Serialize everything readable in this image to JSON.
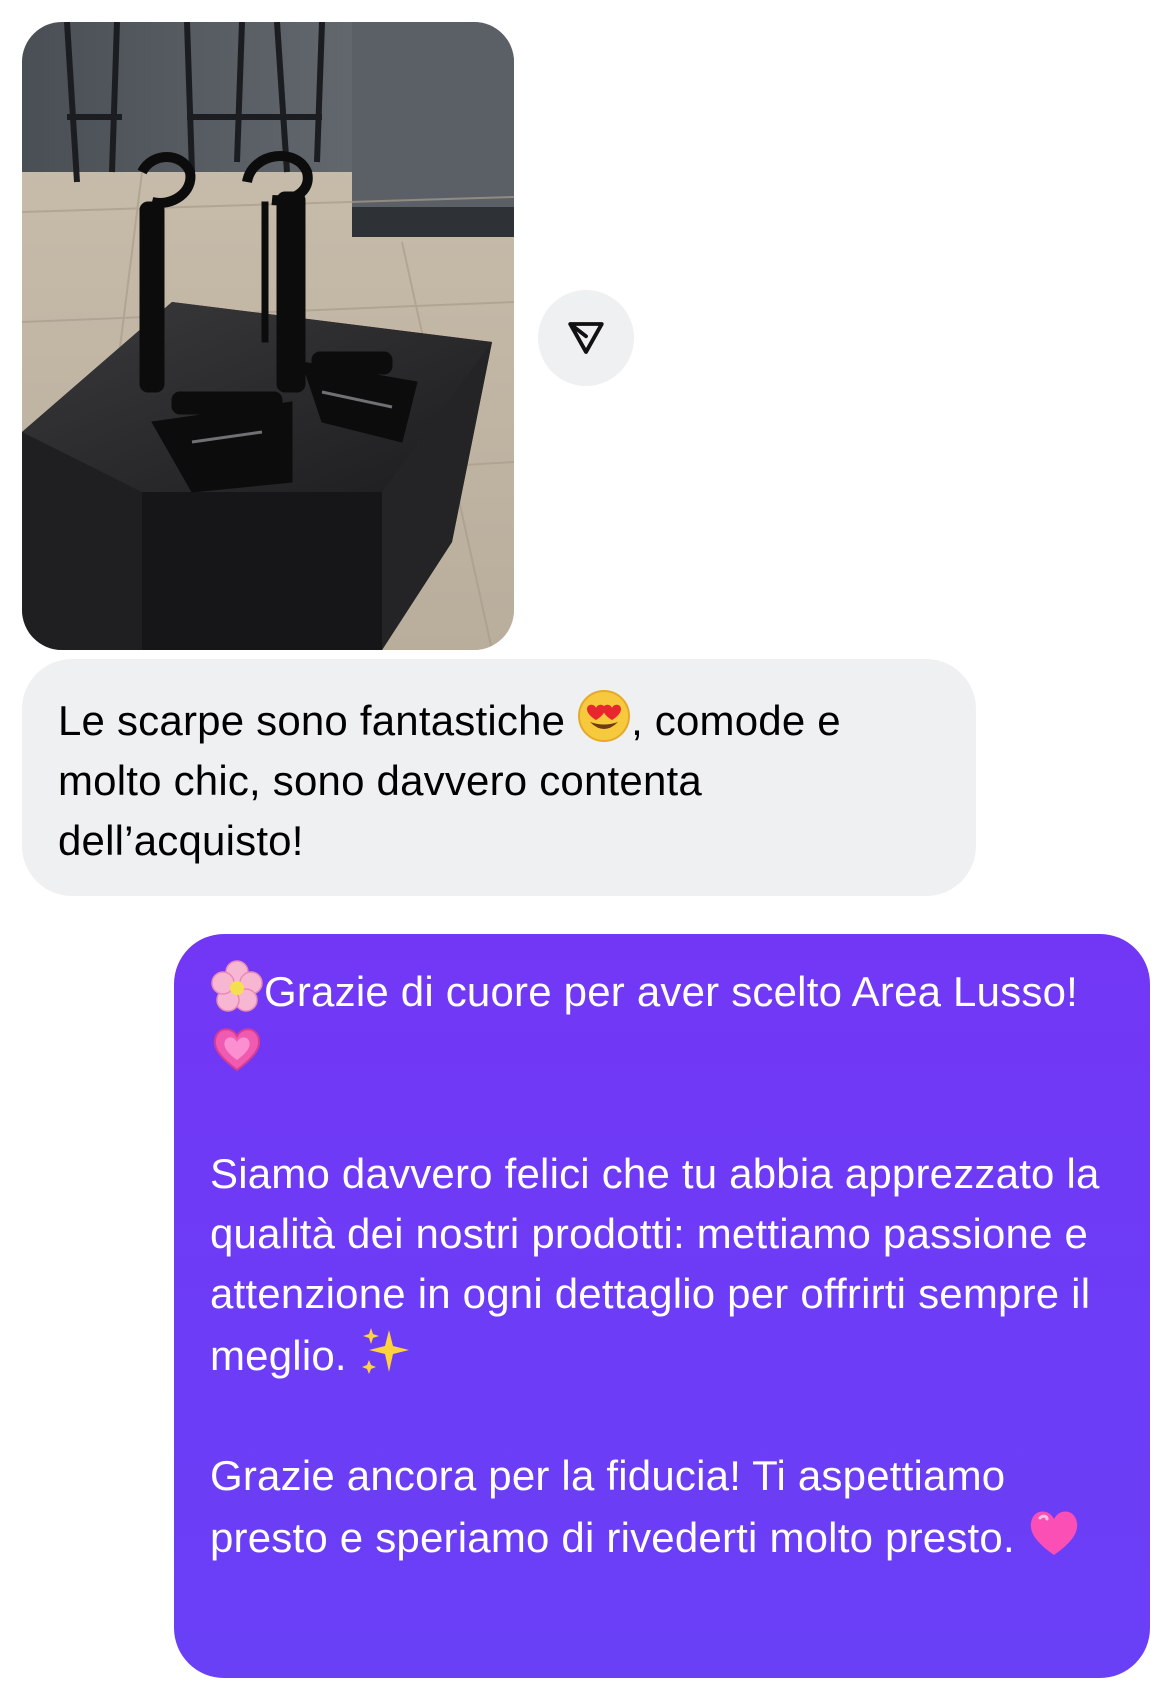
{
  "messages": [
    {
      "type": "image",
      "direction": "incoming",
      "alt_icon": "photo-sandals-on-box"
    },
    {
      "type": "text",
      "direction": "incoming",
      "text_part1": "Le scarpe sono fantastiche ",
      "emoji1": "heart-eyes-emoji",
      "text_part2": ", comode e molto chic, sono davvero contenta dell’acquisto!"
    },
    {
      "type": "text",
      "direction": "outgoing",
      "para1_emoji_start": "cherry-blossom-emoji",
      "para1_text": "Grazie di cuore per aver scelto Area Lusso!",
      "para1_emoji_end": "growing-heart-emoji",
      "para2_text": "Siamo davvero felici che tu abbia apprezzato la qualità dei nostri prodotti: mettiamo passione e attenzione in ogni dettaglio per offrirti sempre il meglio. ",
      "para2_emoji_end": "sparkles-emoji",
      "para3_text": "Grazie ancora per la fiducia! Ti aspettiamo presto e speriamo di rivederti molto presto. ",
      "para3_emoji_end": "pink-heart-emoji"
    }
  ],
  "share_button": {
    "icon": "share-send-icon"
  },
  "colors": {
    "incoming_bubble": "#eef0f2",
    "outgoing_bubble": "#6b3cf6",
    "outgoing_text": "#ffffff",
    "incoming_text": "#000000"
  }
}
